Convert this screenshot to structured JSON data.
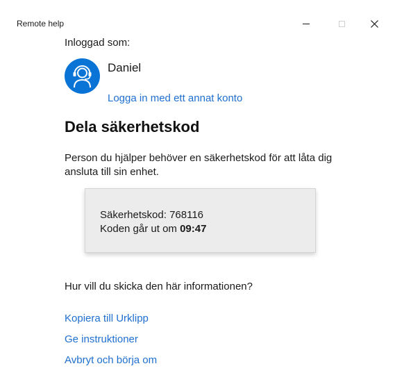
{
  "window": {
    "title": "Remote help",
    "controls": {
      "minimize_icon": "minimize-icon",
      "maximize_icon": "maximize-icon",
      "close_icon": "close-icon",
      "close_glyph": "✕"
    }
  },
  "account": {
    "logged_in_label": "Inloggad som:",
    "user_name": "Daniel",
    "avatar_icon": "support-agent-headset-icon",
    "switch_account_link": "Logga in med ett annat konto"
  },
  "main": {
    "heading": "Dela säkerhetskod",
    "description": "Person du hjälper behöver en säkerhetskod för att låta dig ansluta till sin enhet.",
    "code_card": {
      "code_label": "Säkerhetskod:",
      "code_value": "768116",
      "expires_label": "Koden går ut om",
      "expires_time": "09:47"
    },
    "question": "Hur vill du skicka den här informationen?",
    "actions": {
      "copy_link": "Kopiera till Urklipp",
      "instructions_link": "Ge instruktioner",
      "cancel_link": "Avbryt och börja om"
    }
  },
  "colors": {
    "accent_blue": "#0a74d6",
    "link_blue": "#1f6fd0",
    "card_background": "#ececec",
    "window_background": "#ffffff"
  }
}
